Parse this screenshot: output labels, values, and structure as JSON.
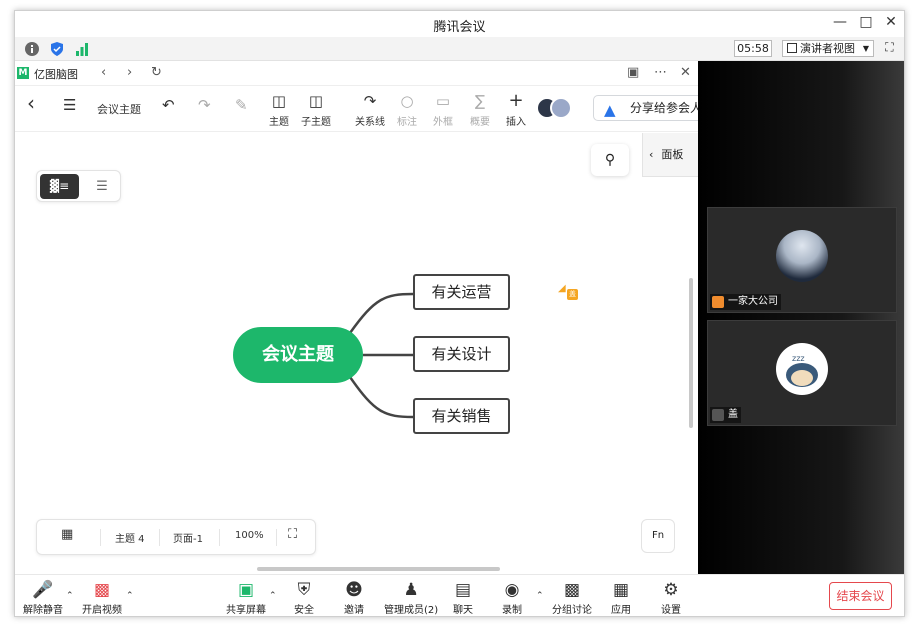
{
  "window": {
    "title": "腾讯会议"
  },
  "infobar": {
    "time": "05:58",
    "view_mode": "演讲者视图"
  },
  "app": {
    "name": "亿图脑图",
    "doc_title": "会议主题",
    "share_button": "分享给参会人",
    "panel_label": "面板"
  },
  "toolbar": {
    "topic": "主题",
    "subtopic": "子主题",
    "relation": "关系线",
    "label": "标注",
    "frame": "外框",
    "summary": "概要",
    "insert": "插入"
  },
  "mindmap": {
    "center": "会议主题",
    "branches": [
      "有关运营",
      "有关设计",
      "有关销售"
    ],
    "cursor_badge": "盖"
  },
  "statusbar": {
    "topic_count": "主题 4",
    "page": "页面-1",
    "zoom": "100%",
    "fn": "Fn"
  },
  "participants": [
    {
      "name": "一家大公司"
    },
    {
      "name": "盖"
    }
  ],
  "meeting_bar": {
    "unmute": "解除静音",
    "video": "开启视频",
    "share_screen": "共享屏幕",
    "security": "安全",
    "invite": "邀请",
    "manage": "管理成员(2)",
    "chat": "聊天",
    "record": "录制",
    "breakout": "分组讨论",
    "apps": "应用",
    "settings": "设置",
    "end": "结束会议"
  },
  "colors": {
    "accent_green": "#1db76b",
    "end_red": "#e5484d",
    "participant_orange": "#f08c2e"
  }
}
